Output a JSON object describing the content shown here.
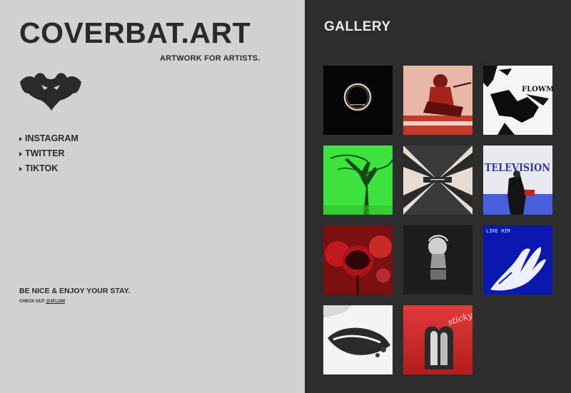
{
  "left": {
    "brand": "COVERBAT.ART",
    "tagline": "ARTWORK FOR ARTISTS.",
    "logo_icon": "bat-icon",
    "social": [
      {
        "label": "INSTAGRAM",
        "icon": "triangle-right-icon"
      },
      {
        "label": "TWITTER",
        "icon": "triangle-right-icon"
      },
      {
        "label": "TIKTOK",
        "icon": "triangle-right-icon"
      }
    ],
    "footer_text": "BE NICE & ENJOY YOUR STAY.",
    "check_prefix": "CHECK OUT ",
    "check_link": "@3FLOW"
  },
  "gallery": {
    "title": "GALLERY",
    "tiles": [
      {
        "name": "ring-cover",
        "text": ""
      },
      {
        "name": "red-rider-cover",
        "text": ""
      },
      {
        "name": "flowm-cover",
        "text": "FLOWM"
      },
      {
        "name": "green-tree-cover",
        "text": ""
      },
      {
        "name": "burst-cover",
        "text": ""
      },
      {
        "name": "television-cover",
        "text": "TELEVISION"
      },
      {
        "name": "red-flower-cover",
        "text": ""
      },
      {
        "name": "bust-statue-cover",
        "text": ""
      },
      {
        "name": "like-him-cover",
        "text": "LIKE HIM"
      },
      {
        "name": "lips-cover",
        "text": ""
      },
      {
        "name": "sticky-cover",
        "text": "sticky"
      }
    ]
  },
  "colors": {
    "left_bg": "#d1d1d1",
    "right_bg": "#2d2d2d",
    "text_dark": "#2a2a2a",
    "text_light": "#e9e9e9"
  }
}
